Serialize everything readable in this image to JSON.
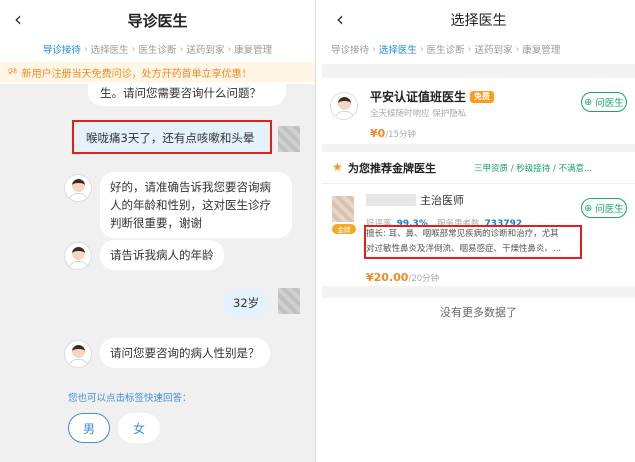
{
  "left": {
    "title": "导诊医生",
    "steps": [
      "导诊接待",
      "选择医生",
      "医生诊断",
      "送药到家",
      "康复管理"
    ],
    "step_sep": "›",
    "notice": "新用户注册当天免费问诊，处方开药首单立享优惠！",
    "messages": {
      "doctor_tail": "生。请问您需要咨询什么问题？",
      "user_symptom": "喉咙痛3天了，还有点咳嗽和头晕",
      "doctor_ask_gender_age": [
        "好的，请准确告诉我您要咨询病",
        "人的年龄和性别，这对医生诊疗",
        "判断很重要，谢谢"
      ],
      "doctor_ask_age": "请告诉我病人的年龄",
      "user_age": "32岁",
      "doctor_ask_gender": "请问您要咨询的病人性别是？"
    },
    "quick_hint": "您也可以点击标签快速回答：",
    "quick_options": [
      "男",
      "女"
    ]
  },
  "right": {
    "title": "选择医生",
    "steps": [
      "导诊接待",
      "选择医生",
      "医生诊断",
      "送药到家",
      "康复管理"
    ],
    "step_sep": "›",
    "duty_doctor": {
      "name": "平安认证值班医生",
      "badge": "免费",
      "desc": "全天候随时响应 保护隐私",
      "price": "¥0",
      "wait": "/15分钟",
      "button": "问医生"
    },
    "recommend": {
      "heading": "为您推荐金牌医生",
      "tags": "三甲资质 / 秒级接待 / 不满意...",
      "doctor": {
        "title": "主治医师",
        "medal": "金牌",
        "rating_label": "好评率",
        "rating": "99.3%",
        "served_label": "服务患者数",
        "served": "733792",
        "specialty_lines": [
          "擅长: 耳、鼻、咽喉部常见疾病的诊断和治疗，尤其",
          "对过敏性鼻炎及泮倒流、咽易感症、干燥性鼻炎、..."
        ],
        "price": "¥20.00",
        "wait": "/20分钟",
        "button": "问医生"
      }
    },
    "no_more": "没有更多数据了"
  }
}
